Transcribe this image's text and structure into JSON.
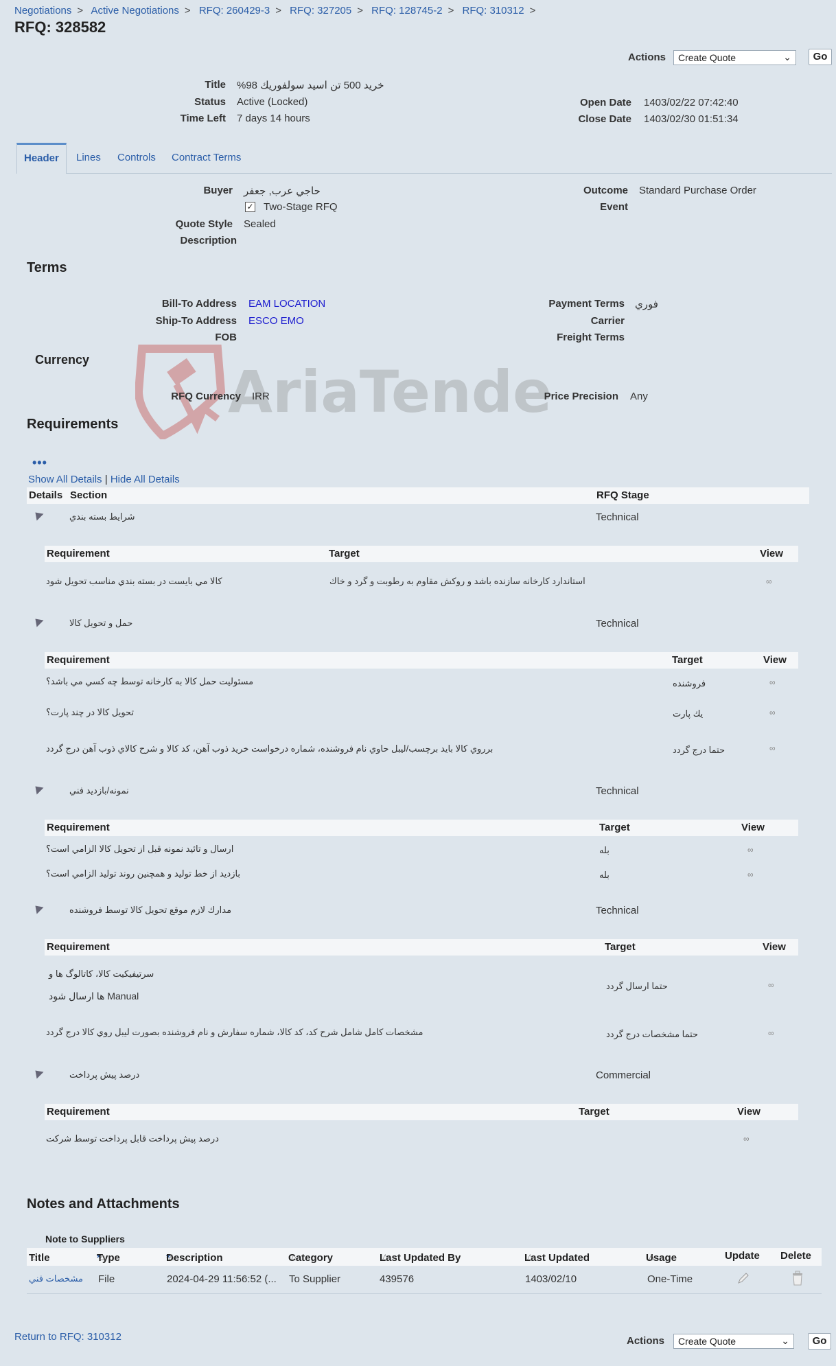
{
  "breadcrumb": {
    "items": [
      "Negotiations",
      "Active Negotiations",
      "RFQ: 260429-3",
      "RFQ: 327205",
      "RFQ: 128745-2",
      "RFQ: 310312"
    ],
    "sep": ">"
  },
  "page_title": "RFQ: 328582",
  "actions": {
    "label": "Actions",
    "selected": "Create Quote",
    "go": "Go"
  },
  "summary": {
    "title_label": "Title",
    "title_value": "خريد 500 تن اسيد سولفوريك 98%",
    "status_label": "Status",
    "status_value": "Active (Locked)",
    "time_left_label": "Time Left",
    "time_left_value": "7 days 14 hours",
    "open_date_label": "Open Date",
    "open_date_value": "1403/02/22 07:42:40",
    "close_date_label": "Close Date",
    "close_date_value": "1403/02/30 01:51:34"
  },
  "tabs": [
    "Header",
    "Lines",
    "Controls",
    "Contract Terms"
  ],
  "header": {
    "buyer_label": "Buyer",
    "buyer_value": "حاجي عرب, جعفر",
    "two_stage_label": "Two-Stage RFQ",
    "two_stage_checked": true,
    "quote_style_label": "Quote Style",
    "quote_style_value": "Sealed",
    "description_label": "Description",
    "outcome_label": "Outcome",
    "outcome_value": "Standard Purchase Order",
    "event_label": "Event"
  },
  "terms": {
    "heading": "Terms",
    "bill_to_label": "Bill-To Address",
    "bill_to_value": "EAM LOCATION",
    "ship_to_label": "Ship-To Address",
    "ship_to_value": "ESCO EMO",
    "fob_label": "FOB",
    "payment_terms_label": "Payment Terms",
    "payment_terms_value": "فوري",
    "carrier_label": "Carrier",
    "freight_terms_label": "Freight Terms"
  },
  "currency": {
    "heading": "Currency",
    "rfq_currency_label": "RFQ Currency",
    "rfq_currency_value": "IRR",
    "price_precision_label": "Price Precision",
    "price_precision_value": "Any"
  },
  "watermark_text": "AriaTender.neT",
  "requirements": {
    "heading": "Requirements",
    "show_all": "Show All Details",
    "divider": "|",
    "hide_all": "Hide All Details",
    "col_details": "Details",
    "col_section": "Section",
    "col_stage": "RFQ Stage",
    "sub_col_requirement": "Requirement",
    "sub_col_target": "Target",
    "sub_col_view": "View",
    "sections": [
      {
        "name": "شرايط بسته بندي",
        "stage": "Technical",
        "rows": [
          {
            "req": "كالا مي بايست در بسته بندي مناسب تحويل شود",
            "target": "استاندارد كارخانه سازنده باشد و روكش مقاوم به رطوبت و گرد و خاك"
          }
        ]
      },
      {
        "name": "حمل و تحويل كالا",
        "stage": "Technical",
        "rows": [
          {
            "req": "مسئوليت حمل كالا به كارخانه توسط چه كسي مي باشد؟",
            "target": "فروشنده"
          },
          {
            "req": "تحويل كالا در چند پارت؟",
            "target": "يك پارت"
          },
          {
            "req": "برروي كالا بايد برچسب/ليبل حاوي نام فروشنده، شماره درخواست خريد ذوب آهن، كد كالا و شرح كالاي ذوب آهن درج گردد",
            "target": "حتما درج گردد"
          }
        ]
      },
      {
        "name": "نمونه/بازديد فني",
        "stage": "Technical",
        "rows": [
          {
            "req": "ارسال و تائيد نمونه قبل از تحويل كالا الزامي است؟",
            "target": "بله"
          },
          {
            "req": "بازديد از خط توليد و همچنين روند توليد الزامي است؟",
            "target": "بله"
          }
        ]
      },
      {
        "name": "مدارك لازم موقع تحويل كالا توسط فروشنده",
        "stage": "Technical",
        "rows": [
          {
            "req": "سرتيفيكيت كالا، كاتالوگ ها و",
            "req2": "Manual  ها ارسال شود",
            "target": "حتما ارسال گردد"
          },
          {
            "req": "مشخصات كامل شامل شرح كد، كد كالا، شماره سفارش و نام فروشنده بصورت ليبل روي كالا درج گردد",
            "target": "حتما مشخصات درج گردد"
          }
        ]
      },
      {
        "name": "درصد پيش پرداخت",
        "stage": "Commercial",
        "rows": [
          {
            "req": "درصد پيش پرداخت قابل پرداخت توسط شركت",
            "target": ""
          }
        ]
      }
    ]
  },
  "notes": {
    "heading": "Notes and Attachments",
    "note_label": "Note to Suppliers",
    "columns": [
      "Title",
      "Type",
      "Description",
      "Category",
      "Last Updated By",
      "Last Updated",
      "Usage",
      "Update",
      "Delete"
    ],
    "required_mark": "*",
    "row": {
      "title": "مشخصات فني",
      "type": "File",
      "description": "2024-04-29 11:56:52 (...",
      "category": "To Supplier",
      "last_updated_by": "439576",
      "last_updated": "1403/02/10",
      "usage": "One-Time"
    }
  },
  "footer": {
    "return_link": "Return to RFQ: 310312"
  }
}
